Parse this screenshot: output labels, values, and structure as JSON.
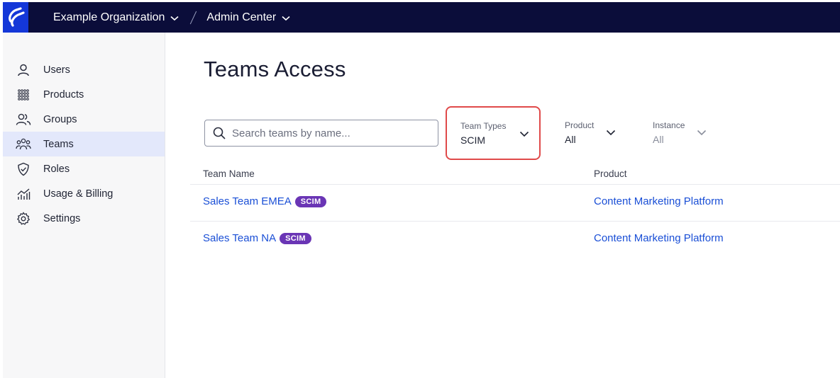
{
  "topbar": {
    "organization": "Example Organization",
    "section": "Admin Center"
  },
  "sidebar": {
    "items": [
      {
        "label": "Users",
        "icon": "user-icon",
        "active": false
      },
      {
        "label": "Products",
        "icon": "grid-icon",
        "active": false
      },
      {
        "label": "Groups",
        "icon": "group-icon",
        "active": false
      },
      {
        "label": "Teams",
        "icon": "team-icon",
        "active": true
      },
      {
        "label": "Roles",
        "icon": "shield-check-icon",
        "active": false
      },
      {
        "label": "Usage & Billing",
        "icon": "chart-icon",
        "active": false
      },
      {
        "label": "Settings",
        "icon": "gear-icon",
        "active": false
      }
    ]
  },
  "page": {
    "title": "Teams Access"
  },
  "search": {
    "placeholder": "Search teams by name..."
  },
  "filters": {
    "team_types": {
      "label": "Team Types",
      "value": "SCIM"
    },
    "product": {
      "label": "Product",
      "value": "All"
    },
    "instance": {
      "label": "Instance",
      "value": "All"
    }
  },
  "table": {
    "columns": [
      "Team Name",
      "Product"
    ],
    "rows": [
      {
        "name": "Sales Team EMEA",
        "badge": "SCIM",
        "product": "Content Marketing Platform"
      },
      {
        "name": "Sales Team NA",
        "badge": "SCIM",
        "product": "Content Marketing Platform"
      }
    ]
  },
  "colors": {
    "topbar": "#0b0d3a",
    "logo_bg": "#1437d8",
    "link": "#1a4fd6",
    "badge": "#6a35b5",
    "highlight": "#e04a4a",
    "active_nav": "#e3e8fb"
  }
}
